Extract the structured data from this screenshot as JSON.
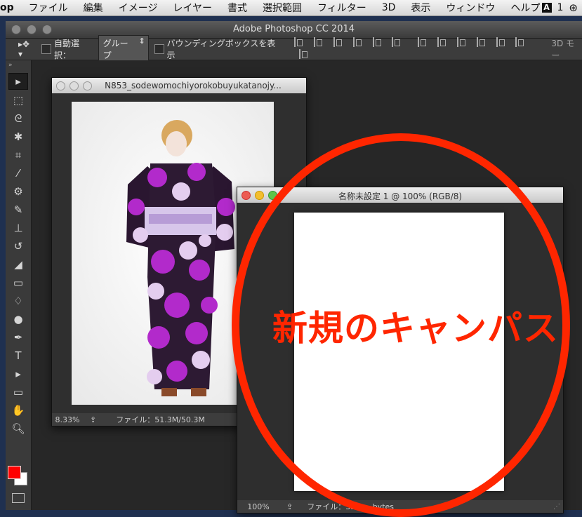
{
  "menubar": {
    "app": "op",
    "items": [
      "ファイル",
      "編集",
      "イメージ",
      "レイヤー",
      "書式",
      "選択範囲",
      "フィルター",
      "3D",
      "表示",
      "ウィンドウ",
      "ヘルプ"
    ],
    "right_count": "1"
  },
  "app_window": {
    "title": "Adobe Photoshop CC 2014"
  },
  "options_bar": {
    "auto_select_label": "自動選択：",
    "auto_select_value": "グループ",
    "bounding_box_label": "バウンディングボックスを表示",
    "mode_3d_label": "3D モー"
  },
  "doc1": {
    "title": "N853_sodewomochiyorokobuyukatanojy...",
    "zoom": "8.33%",
    "file_info": "ファイル：51.3M/50.3M"
  },
  "doc2": {
    "title": "名称未設定 1 @ 100% (RGB/8)",
    "zoom": "100%",
    "file_info": "ファイル：351.... bytes"
  },
  "annotation": {
    "text": "新規のキャンパス",
    "color": "#ff2600"
  },
  "colors": {
    "foreground": "#ff0000",
    "background": "#ffffff"
  }
}
